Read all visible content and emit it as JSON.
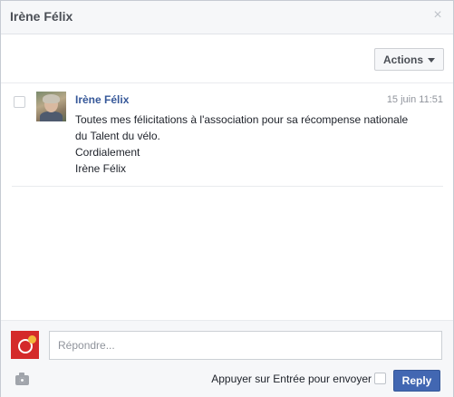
{
  "header": {
    "title": "Irène Félix",
    "close_icon": "×"
  },
  "toolbar": {
    "actions_label": "Actions"
  },
  "message": {
    "sender": "Irène Félix",
    "time": "15 juin 11:51",
    "lines": [
      "Toutes mes félicitations à l'association pour sa récompense nationale",
      "du Talent du vélo.",
      "Cordialement",
      "Irène Félix"
    ]
  },
  "composer": {
    "placeholder": "Répondre...",
    "enter_label": "Appuyer sur Entrée pour envoyer",
    "reply_label": "Reply"
  },
  "colors": {
    "accent": "#4267b2",
    "link": "#365899",
    "avatar_brand": "#d42a2a"
  },
  "icons": [
    "close-icon",
    "caret-down-icon",
    "camera-icon"
  ]
}
